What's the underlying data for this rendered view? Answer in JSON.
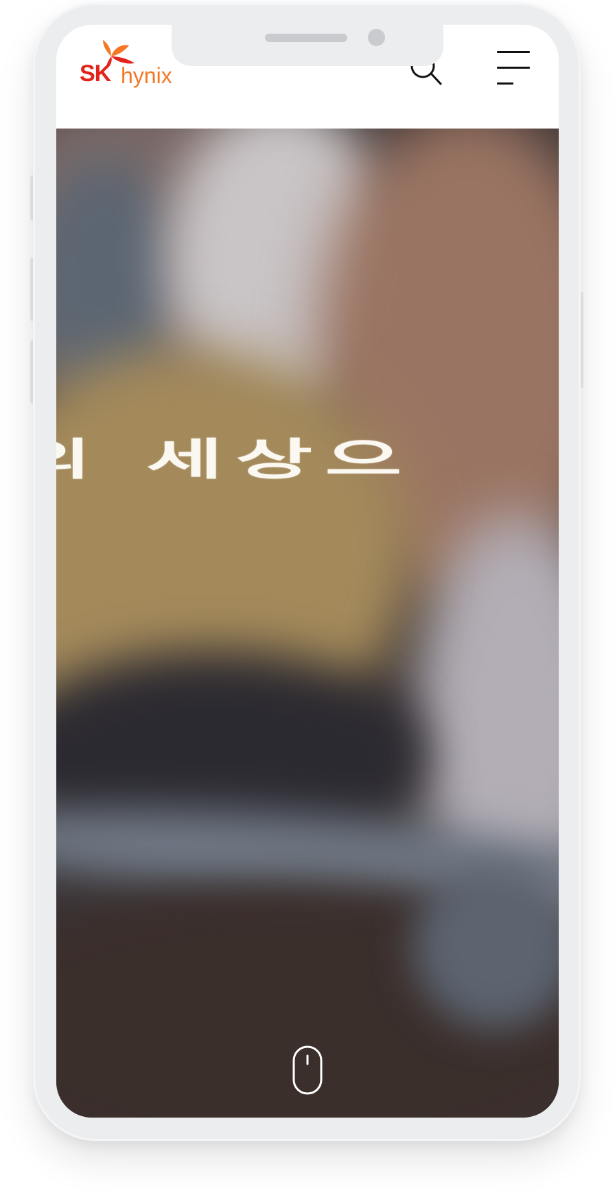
{
  "brand": {
    "logo_primary": "SK",
    "logo_secondary": "hynix",
    "colors": {
      "red": "#e2231a",
      "orange": "#f47725"
    }
  },
  "header": {
    "search_icon": "search-icon",
    "menu_icon": "hamburger-menu-icon"
  },
  "hero": {
    "headline": "의 세상으"
  },
  "scroll": {
    "icon": "mouse-scroll-icon"
  }
}
